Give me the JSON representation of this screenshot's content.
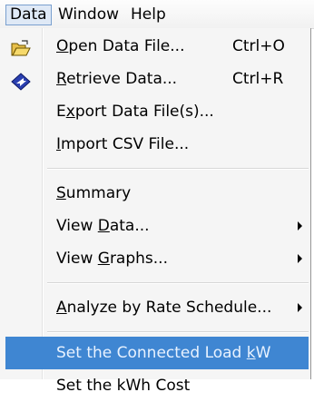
{
  "menubar": {
    "items": [
      {
        "label": "Data"
      },
      {
        "label": "Window"
      },
      {
        "label": "Help"
      }
    ]
  },
  "menu": {
    "items": [
      {
        "pre": "",
        "u": "O",
        "post": "pen Data File...",
        "shortcut": "Ctrl+O",
        "icon": "open-folder-icon"
      },
      {
        "pre": "",
        "u": "R",
        "post": "etrieve Data...",
        "shortcut": "Ctrl+R",
        "icon": "diamond-arrow-icon"
      },
      {
        "pre": "E",
        "u": "x",
        "post": "port Data File(s)...",
        "shortcut": ""
      },
      {
        "pre": "",
        "u": "I",
        "post": "mport CSV File...",
        "shortcut": ""
      },
      {
        "pre": "",
        "u": "S",
        "post": "ummary",
        "shortcut": ""
      },
      {
        "pre": "View ",
        "u": "D",
        "post": "ata...",
        "shortcut": "",
        "submenu": true
      },
      {
        "pre": "View ",
        "u": "G",
        "post": "raphs...",
        "shortcut": "",
        "submenu": true
      },
      {
        "pre": "",
        "u": "A",
        "post": "nalyze by Rate Schedule...",
        "shortcut": "",
        "submenu": true
      },
      {
        "pre": "Set the Connected Load ",
        "u": "k",
        "post": "W",
        "shortcut": "",
        "selected": true
      },
      {
        "pre": "Set the kWh Cost",
        "u": "",
        "post": "",
        "shortcut": ""
      }
    ]
  },
  "colors": {
    "selection": "#3f86d2",
    "menu_bg": "#f5f5f5"
  }
}
